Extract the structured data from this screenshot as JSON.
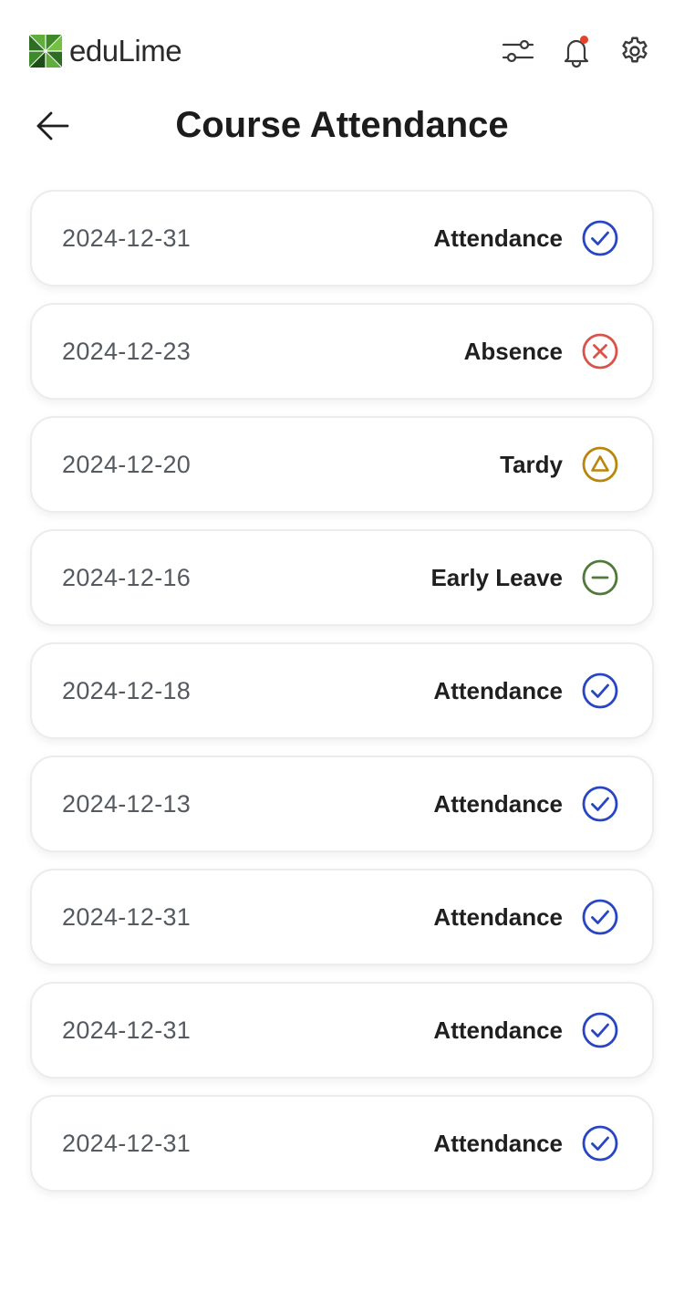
{
  "app": {
    "name": "eduLime",
    "logo_icon": "edulime-logo-icon"
  },
  "toolbar": {
    "icons": [
      "filter-sliders-icon",
      "bell-icon",
      "gear-icon"
    ],
    "notification_dot": true,
    "notification_color": "#e4442a"
  },
  "header": {
    "back_icon": "arrow-left-icon",
    "title": "Course Attendance"
  },
  "status_colors": {
    "Attendance": "#2846c4",
    "Absence": "#d9534a",
    "Tardy": "#b8860b",
    "Early Leave": "#4f7a3a"
  },
  "records": [
    {
      "date": "2024-12-31",
      "status": "Attendance",
      "icon": "check-circle-icon"
    },
    {
      "date": "2024-12-23",
      "status": "Absence",
      "icon": "x-circle-icon"
    },
    {
      "date": "2024-12-20",
      "status": "Tardy",
      "icon": "triangle-circle-icon"
    },
    {
      "date": "2024-12-16",
      "status": "Early Leave",
      "icon": "minus-circle-icon"
    },
    {
      "date": "2024-12-18",
      "status": "Attendance",
      "icon": "check-circle-icon"
    },
    {
      "date": "2024-12-13",
      "status": "Attendance",
      "icon": "check-circle-icon"
    },
    {
      "date": "2024-12-31",
      "status": "Attendance",
      "icon": "check-circle-icon"
    },
    {
      "date": "2024-12-31",
      "status": "Attendance",
      "icon": "check-circle-icon"
    },
    {
      "date": "2024-12-31",
      "status": "Attendance",
      "icon": "check-circle-icon"
    }
  ]
}
